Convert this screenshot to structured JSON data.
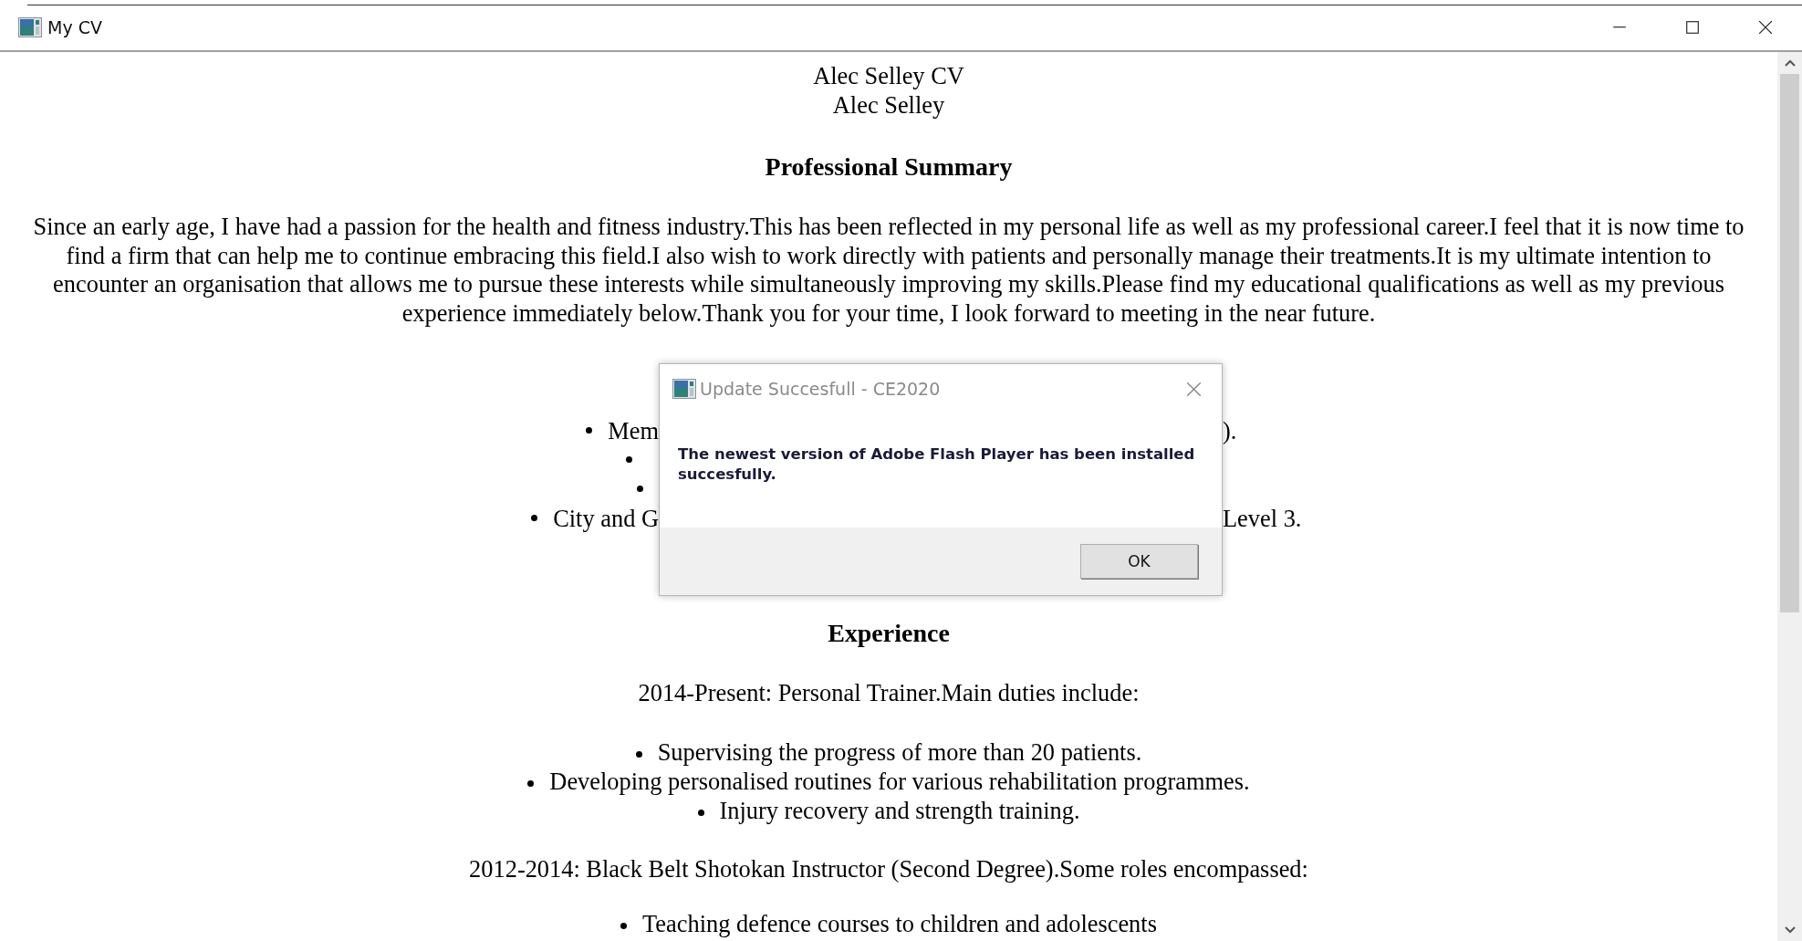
{
  "window": {
    "title": "My CV"
  },
  "document": {
    "title": "Alec Selley CV",
    "author": "Alec Selley",
    "summary": {
      "heading": "Professional Summary",
      "paragraph": "Since an early age, I have had a passion for the health and fitness industry.This has been reflected in my personal life as well as my professional career.I feel that it is now time to find a firm that can help me to continue embracing this field.I also wish to work directly with patients and personally manage their treatments.It is my ultimate intention to encounter an organisation that allows me to pursue these interests while simultaneously improving my skills.Please find my educational qualifications as well as my previous experience immediately below.Thank you for your time, I look forward to meeting in the near future."
    },
    "covered_list": [
      {
        "left": "Mem",
        "right": ").",
        "children": [
          {
            "kind": "bullet"
          },
          {
            "kind": "bullet"
          }
        ]
      },
      {
        "left": "City and G",
        "right": "Level 3."
      }
    ],
    "experience": {
      "heading": "Experience",
      "blocks": [
        {
          "intro": "2014-Present: Personal Trainer.Main duties include:",
          "items": [
            "Supervising the progress of more than 20 patients.",
            "Developing personalised routines for various rehabilitation programmes.",
            "Injury recovery and strength training."
          ]
        },
        {
          "intro": "2012-2014: Black Belt Shotokan Instructor (Second Degree).Some roles encompassed:",
          "items": [
            "Teaching defence courses to children and adolescents"
          ]
        }
      ]
    }
  },
  "dialog": {
    "title": "Update Succesfull - CE2020",
    "message": "The newest version of Adobe Flash Player has been installed succesfully.",
    "buttons": [
      "OK"
    ]
  }
}
